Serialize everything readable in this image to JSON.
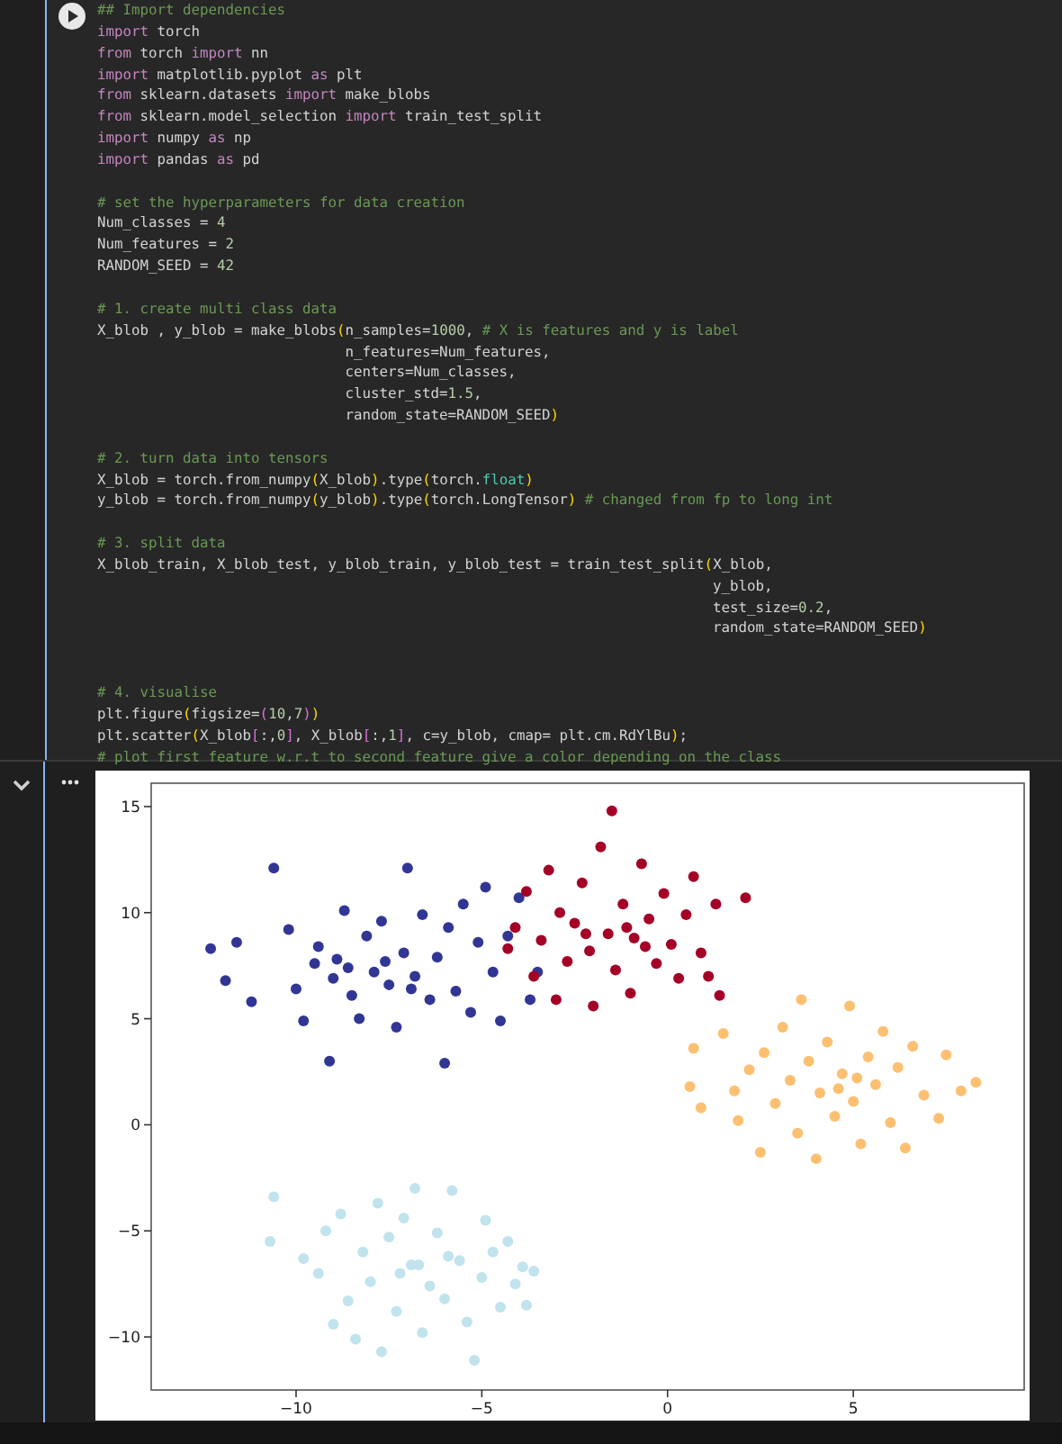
{
  "code_cell": {
    "blocks": [
      {
        "kind": "top",
        "lines": [
          [
            {
              "text": "## Import dependencies",
              "kind": "comment"
            }
          ],
          [
            {
              "text": "import",
              "kind": "keyword"
            },
            {
              "text": " torch",
              "kind": "plain"
            }
          ],
          [
            {
              "text": "from",
              "kind": "keyword"
            },
            {
              "text": " torch ",
              "kind": "plain"
            },
            {
              "text": "import",
              "kind": "keyword"
            },
            {
              "text": " nn",
              "kind": "plain"
            }
          ],
          [
            {
              "text": "import",
              "kind": "keyword"
            },
            {
              "text": " matplotlib.pyplot ",
              "kind": "plain"
            },
            {
              "text": "as",
              "kind": "keyword"
            },
            {
              "text": " plt",
              "kind": "plain"
            }
          ],
          [
            {
              "text": "from",
              "kind": "keyword"
            },
            {
              "text": " sklearn.datasets ",
              "kind": "plain"
            },
            {
              "text": "import",
              "kind": "keyword"
            },
            {
              "text": " make_blobs",
              "kind": "plain"
            }
          ],
          [
            {
              "text": "from",
              "kind": "keyword"
            },
            {
              "text": " sklearn.model_selection ",
              "kind": "plain"
            },
            {
              "text": "import",
              "kind": "keyword"
            },
            {
              "text": " train_test_split",
              "kind": "plain"
            }
          ],
          [
            {
              "text": "import",
              "kind": "keyword"
            },
            {
              "text": " numpy ",
              "kind": "plain"
            },
            {
              "text": "as",
              "kind": "keyword"
            },
            {
              "text": " np",
              "kind": "plain"
            }
          ],
          [
            {
              "text": "import",
              "kind": "keyword"
            },
            {
              "text": " pandas ",
              "kind": "plain"
            },
            {
              "text": "as",
              "kind": "keyword"
            },
            {
              "text": " pd",
              "kind": "plain"
            }
          ]
        ]
      },
      {
        "kind": "spaced",
        "lines": [
          [
            {
              "text": "# set the hyperparameters for data creation",
              "kind": "comment"
            }
          ],
          [
            {
              "text": "Num_classes = ",
              "kind": "plain"
            },
            {
              "text": "4",
              "kind": "number"
            }
          ],
          [
            {
              "text": "Num_features = ",
              "kind": "plain"
            },
            {
              "text": "2",
              "kind": "number"
            }
          ],
          [
            {
              "text": "RANDOM_SEED = ",
              "kind": "plain"
            },
            {
              "text": "42",
              "kind": "number"
            }
          ]
        ]
      },
      {
        "kind": "spaced",
        "lines": [
          [
            {
              "text": "# 1. create multi class data",
              "kind": "comment"
            }
          ],
          [
            {
              "text": "X_blob , y_blob = make_blobs",
              "kind": "plain"
            },
            {
              "text": "(",
              "kind": "bracket"
            },
            {
              "text": "n_samples=",
              "kind": "plain"
            },
            {
              "text": "1000",
              "kind": "number"
            },
            {
              "text": ", ",
              "kind": "plain"
            },
            {
              "text": "# X is features and y is label",
              "kind": "comment"
            }
          ],
          [
            {
              "text": "                             n_features=Num_features,",
              "kind": "plain"
            }
          ],
          [
            {
              "text": "                             centers=Num_classes,",
              "kind": "plain"
            }
          ],
          [
            {
              "text": "                             cluster_std=",
              "kind": "plain"
            },
            {
              "text": "1.5",
              "kind": "number"
            },
            {
              "text": ",",
              "kind": "plain"
            }
          ],
          [
            {
              "text": "                             random_state=RANDOM_SEED",
              "kind": "plain"
            },
            {
              "text": ")",
              "kind": "bracket"
            }
          ]
        ]
      },
      {
        "kind": "spaced",
        "lines": [
          [
            {
              "text": "# 2. turn data into tensors",
              "kind": "comment"
            }
          ],
          [
            {
              "text": "X_blob = torch.from_numpy",
              "kind": "plain"
            },
            {
              "text": "(",
              "kind": "bracket"
            },
            {
              "text": "X_blob",
              "kind": "plain"
            },
            {
              "text": ")",
              "kind": "bracket"
            },
            {
              "text": ".type",
              "kind": "plain"
            },
            {
              "text": "(",
              "kind": "bracket"
            },
            {
              "text": "torch.",
              "kind": "plain"
            },
            {
              "text": "float",
              "kind": "type"
            },
            {
              "text": ")",
              "kind": "bracket"
            }
          ],
          [
            {
              "text": "y_blob = torch.from_numpy",
              "kind": "plain"
            },
            {
              "text": "(",
              "kind": "bracket"
            },
            {
              "text": "y_blob",
              "kind": "plain"
            },
            {
              "text": ")",
              "kind": "bracket"
            },
            {
              "text": ".type",
              "kind": "plain"
            },
            {
              "text": "(",
              "kind": "bracket"
            },
            {
              "text": "torch.LongTensor",
              "kind": "plain"
            },
            {
              "text": ")",
              "kind": "bracket"
            },
            {
              "text": " # changed from fp to long int",
              "kind": "comment"
            }
          ]
        ]
      },
      {
        "kind": "spaced",
        "lines": [
          [
            {
              "text": "# 3. split data",
              "kind": "comment"
            }
          ],
          [
            {
              "text": "X_blob_train, X_blob_test, y_blob_train, y_blob_test = train_test_split",
              "kind": "plain"
            },
            {
              "text": "(",
              "kind": "bracket"
            },
            {
              "text": "X_blob,",
              "kind": "plain"
            }
          ],
          [
            {
              "text": "                                                                        y_blob,",
              "kind": "plain"
            }
          ],
          [
            {
              "text": "                                                                        test_size=",
              "kind": "plain"
            },
            {
              "text": "0.2",
              "kind": "number"
            },
            {
              "text": ",",
              "kind": "plain"
            }
          ],
          [
            {
              "text": "                                                                        random_state=RANDOM_SEED",
              "kind": "plain"
            },
            {
              "text": ")",
              "kind": "bracket"
            }
          ]
        ]
      },
      {
        "kind": "wide",
        "lines": [
          [
            {
              "text": "# 4. visualise",
              "kind": "comment"
            }
          ],
          [
            {
              "text": "plt.figure",
              "kind": "plain"
            },
            {
              "text": "(",
              "kind": "bracket"
            },
            {
              "text": "figsize=",
              "kind": "plain"
            },
            {
              "text": "(",
              "kind": "bracket2"
            },
            {
              "text": "10",
              "kind": "number"
            },
            {
              "text": ",",
              "kind": "plain"
            },
            {
              "text": "7",
              "kind": "number"
            },
            {
              "text": ")",
              "kind": "bracket2"
            },
            {
              "text": ")",
              "kind": "bracket"
            }
          ],
          [
            {
              "text": "plt.scatter",
              "kind": "plain"
            },
            {
              "text": "(",
              "kind": "bracket"
            },
            {
              "text": "X_blob",
              "kind": "plain"
            },
            {
              "text": "[",
              "kind": "bracket2"
            },
            {
              "text": ":,",
              "kind": "plain"
            },
            {
              "text": "0",
              "kind": "number"
            },
            {
              "text": "]",
              "kind": "bracket2"
            },
            {
              "text": ", X_blob",
              "kind": "plain"
            },
            {
              "text": "[",
              "kind": "bracket2"
            },
            {
              "text": ":,",
              "kind": "plain"
            },
            {
              "text": "1",
              "kind": "number"
            },
            {
              "text": "]",
              "kind": "bracket2"
            },
            {
              "text": ", c=y_blob, cmap= plt.cm.RdYlBu",
              "kind": "plain"
            },
            {
              "text": ")",
              "kind": "bracket"
            },
            {
              "text": ";",
              "kind": "plain"
            }
          ],
          [
            {
              "text": "# plot first feature w.r.t to second feature give a color depending on the class",
              "kind": "comment"
            }
          ]
        ]
      }
    ]
  },
  "output": {
    "chart_data": {
      "type": "scatter",
      "xlim": [
        -13.9,
        9.6
      ],
      "ylim": [
        -12.5,
        16.1
      ],
      "xticks": [
        {
          "value": -10,
          "label": "−10"
        },
        {
          "value": -5,
          "label": "−5"
        },
        {
          "value": 0,
          "label": "0"
        },
        {
          "value": 5,
          "label": "5"
        }
      ],
      "yticks": [
        {
          "value": -10,
          "label": "−10"
        },
        {
          "value": -5,
          "label": "−5"
        },
        {
          "value": 0,
          "label": "0"
        },
        {
          "value": 5,
          "label": "5"
        },
        {
          "value": 10,
          "label": "10"
        },
        {
          "value": 15,
          "label": "15"
        }
      ],
      "series": [
        {
          "color": "#313695",
          "x": [
            -12.3,
            -11.6,
            -11.9,
            -11.2,
            -10.6,
            -10.2,
            -10.0,
            -9.8,
            -9.5,
            -9.4,
            -9.1,
            -8.9,
            -8.7,
            -8.5,
            -8.3,
            -8.1,
            -7.9,
            -7.7,
            -7.5,
            -7.3,
            -7.1,
            -7.0,
            -6.8,
            -6.6,
            -6.4,
            -6.2,
            -6.0,
            -5.9,
            -5.7,
            -5.5,
            -5.3,
            -5.1,
            -4.9,
            -4.7,
            -4.5,
            -4.3,
            -4.0,
            -3.7,
            -3.5,
            -8.6,
            -7.6,
            -6.9,
            -9.0
          ],
          "values": [
            8.3,
            8.6,
            6.8,
            5.8,
            12.1,
            9.2,
            6.4,
            4.9,
            7.6,
            8.4,
            3.0,
            7.8,
            10.1,
            6.1,
            5.0,
            8.9,
            7.2,
            9.6,
            6.6,
            4.6,
            8.1,
            12.1,
            7.0,
            9.9,
            5.9,
            7.9,
            2.9,
            9.3,
            6.3,
            10.4,
            5.3,
            8.6,
            11.2,
            7.2,
            4.9,
            8.9,
            10.7,
            5.9,
            7.2,
            7.4,
            7.7,
            6.4,
            6.9
          ]
        },
        {
          "color": "#a50026",
          "x": [
            -4.3,
            -4.1,
            -3.8,
            -3.6,
            -3.4,
            -3.2,
            -3.0,
            -2.9,
            -2.7,
            -2.5,
            -2.3,
            -2.1,
            -2.0,
            -1.8,
            -1.6,
            -1.5,
            -1.4,
            -1.2,
            -1.0,
            -0.9,
            -0.7,
            -0.5,
            -0.3,
            -0.1,
            0.1,
            0.3,
            0.5,
            0.7,
            0.9,
            1.1,
            1.3,
            1.4,
            2.1,
            -2.2,
            -1.1,
            -0.6
          ],
          "values": [
            8.3,
            9.3,
            11.0,
            7.0,
            8.7,
            12.0,
            5.9,
            10.0,
            7.7,
            9.5,
            11.4,
            8.2,
            5.6,
            13.1,
            9.0,
            14.8,
            7.3,
            10.4,
            6.2,
            8.8,
            12.3,
            9.7,
            7.6,
            10.9,
            8.5,
            6.9,
            9.9,
            11.7,
            8.1,
            7.0,
            10.4,
            6.1,
            10.7,
            9.0,
            9.3,
            8.4
          ]
        },
        {
          "color": "#fdbf71",
          "x": [
            0.6,
            0.7,
            0.9,
            1.5,
            1.8,
            1.9,
            2.2,
            2.5,
            2.6,
            2.9,
            3.1,
            3.3,
            3.5,
            3.6,
            3.8,
            4.0,
            4.1,
            4.3,
            4.5,
            4.7,
            4.9,
            5.0,
            5.2,
            5.4,
            5.6,
            5.8,
            6.0,
            6.2,
            6.4,
            6.6,
            6.9,
            7.3,
            7.5,
            7.9,
            8.3,
            4.6,
            5.1
          ],
          "values": [
            1.8,
            3.6,
            0.8,
            4.3,
            1.6,
            0.2,
            2.6,
            -1.3,
            3.4,
            1.0,
            4.6,
            2.1,
            -0.4,
            5.9,
            3.0,
            -1.6,
            1.5,
            3.9,
            0.4,
            2.4,
            5.6,
            1.1,
            -0.9,
            3.2,
            1.9,
            4.4,
            0.1,
            2.7,
            -1.1,
            3.7,
            1.4,
            0.3,
            3.3,
            1.6,
            2.0,
            1.7,
            2.2
          ]
        },
        {
          "color": "#c0e3ee",
          "x": [
            -10.7,
            -10.6,
            -9.8,
            -9.4,
            -9.2,
            -9.0,
            -8.8,
            -8.6,
            -8.4,
            -8.2,
            -8.0,
            -7.8,
            -7.7,
            -7.5,
            -7.3,
            -7.1,
            -6.9,
            -6.8,
            -6.6,
            -6.4,
            -6.2,
            -6.0,
            -5.8,
            -5.6,
            -5.4,
            -5.2,
            -5.0,
            -4.9,
            -4.7,
            -4.5,
            -4.3,
            -4.1,
            -3.9,
            -3.8,
            -3.6,
            -6.7,
            -7.2,
            -5.9
          ],
          "values": [
            -5.5,
            -3.4,
            -6.3,
            -7.0,
            -5.0,
            -9.4,
            -4.2,
            -8.3,
            -10.1,
            -6.0,
            -7.4,
            -3.7,
            -10.7,
            -5.3,
            -8.8,
            -4.4,
            -6.6,
            -3.0,
            -9.8,
            -7.6,
            -5.1,
            -8.2,
            -3.1,
            -6.4,
            -9.3,
            -11.1,
            -7.2,
            -4.5,
            -6.0,
            -8.6,
            -5.5,
            -7.5,
            -6.7,
            -8.5,
            -6.9,
            -6.6,
            -7.0,
            -6.2
          ]
        }
      ]
    }
  }
}
